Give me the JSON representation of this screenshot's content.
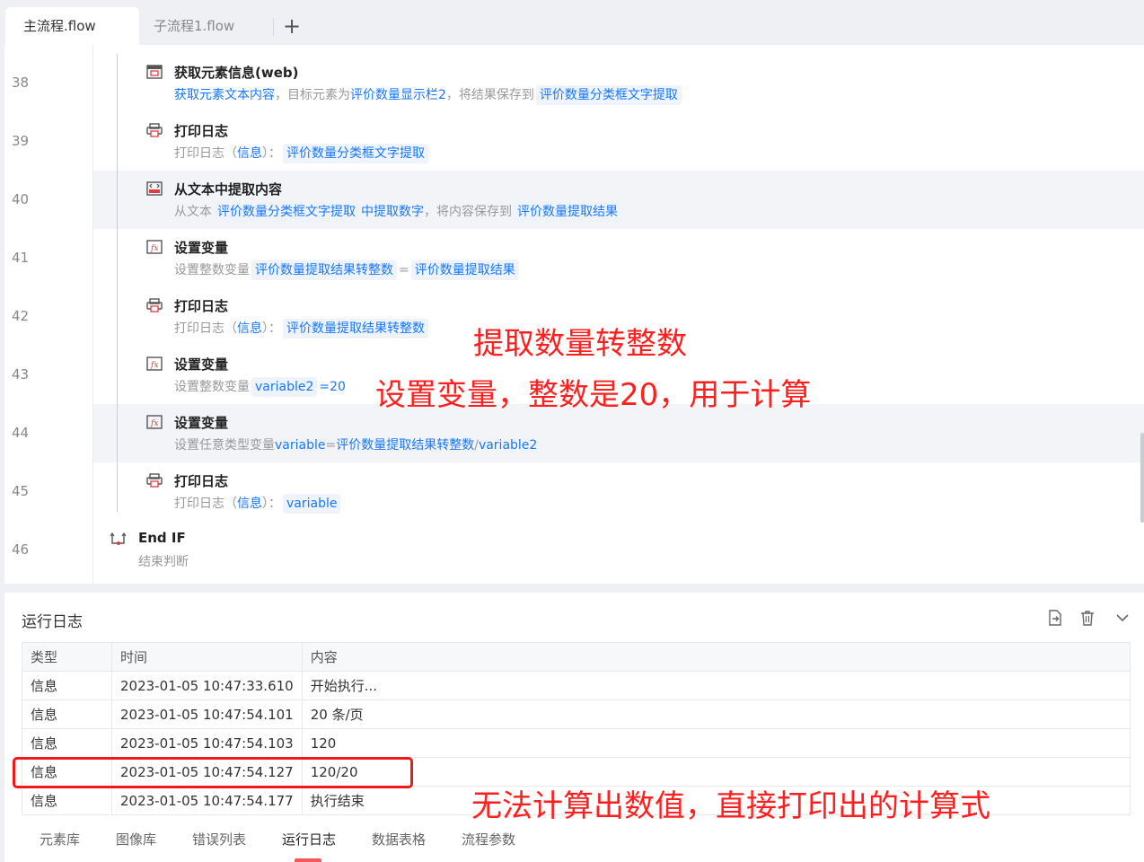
{
  "tabs": {
    "main": "主流程.flow",
    "sub": "子流程1.flow",
    "add": "+"
  },
  "flow_rows": [
    {
      "line": "38",
      "title": "获取元素信息(web)",
      "desc": [
        [
          "b",
          "获取元素文本内容"
        ],
        [
          "g",
          "，目标元素为"
        ],
        [
          "b",
          "评价数量显示栏2"
        ],
        [
          "g",
          "，将结果保存到"
        ],
        [
          "chip",
          "评价数量分类框文字提取"
        ]
      ]
    },
    {
      "line": "39",
      "title": "打印日志",
      "desc": [
        [
          "g",
          "打印日志（"
        ],
        [
          "b",
          "信息"
        ],
        [
          "g",
          "）："
        ],
        [
          "chip",
          "评价数量分类框文字提取"
        ]
      ]
    },
    {
      "line": "40",
      "title": "从文本中提取内容",
      "desc": [
        [
          "g",
          "从文本"
        ],
        [
          "chip",
          "评价数量分类框文字提取"
        ],
        [
          "b",
          "中提取数字"
        ],
        [
          "g",
          "，将内容保存到"
        ],
        [
          "chip",
          "评价数量提取结果"
        ]
      ]
    },
    {
      "line": "41",
      "title": "设置变量",
      "desc": [
        [
          "g",
          "设置整数变量"
        ],
        [
          "chip",
          "评价数量提取结果转整数"
        ],
        [
          "g",
          " = "
        ],
        [
          "chip",
          "评价数量提取结果"
        ]
      ]
    },
    {
      "line": "42",
      "title": "打印日志",
      "desc": [
        [
          "g",
          "打印日志（"
        ],
        [
          "b",
          "信息"
        ],
        [
          "g",
          "）："
        ],
        [
          "chip",
          "评价数量提取结果转整数"
        ]
      ]
    },
    {
      "line": "43",
      "title": "设置变量",
      "desc": [
        [
          "g",
          "设置整数变量"
        ],
        [
          "chip",
          "variable2"
        ],
        [
          "b",
          " =20"
        ]
      ]
    },
    {
      "line": "44",
      "title": "设置变量",
      "desc": [
        [
          "g",
          "设置任意类型变量"
        ],
        [
          "b",
          " variable "
        ],
        [
          "g",
          " = "
        ],
        [
          "b",
          " 评价数量提取结果转整数 "
        ],
        [
          "g",
          " / "
        ],
        [
          "b",
          " variable2"
        ]
      ]
    },
    {
      "line": "45",
      "title": "打印日志",
      "desc": [
        [
          "g",
          "打印日志（"
        ],
        [
          "b",
          "信息"
        ],
        [
          "g",
          "）："
        ],
        [
          "chip",
          "variable"
        ]
      ]
    },
    {
      "line": "46",
      "title": "End IF",
      "desc": [
        [
          "g",
          "结束判断"
        ]
      ]
    }
  ],
  "annotations": {
    "a1": "提取数量转整数",
    "a2": "设置变量，整数是20，用于计算",
    "a3": "无法计算出数值，直接打印出的计算式"
  },
  "log": {
    "title": "运行日志",
    "columns": [
      "类型",
      "时间",
      "内容"
    ],
    "rows": [
      {
        "type": "信息",
        "time": "2023-01-05 10:47:33.610",
        "content": "开始执行..."
      },
      {
        "type": "信息",
        "time": "2023-01-05 10:47:54.101",
        "content": "20 条/页"
      },
      {
        "type": "信息",
        "time": "2023-01-05 10:47:54.103",
        "content": "120"
      },
      {
        "type": "信息",
        "time": "2023-01-05 10:47:54.127",
        "content": "120/20"
      },
      {
        "type": "信息",
        "time": "2023-01-05 10:47:54.177",
        "content": "执行结束"
      }
    ]
  },
  "bottom_tabs": [
    "元素库",
    "图像库",
    "错误列表",
    "运行日志",
    "数据表格",
    "流程参数"
  ],
  "icons": {
    "export": "export-icon",
    "delete": "trash-icon",
    "collapse": "chevron-down-icon"
  },
  "colors": {
    "accent": "#1677ff",
    "annotation": "#ff1f1f"
  }
}
